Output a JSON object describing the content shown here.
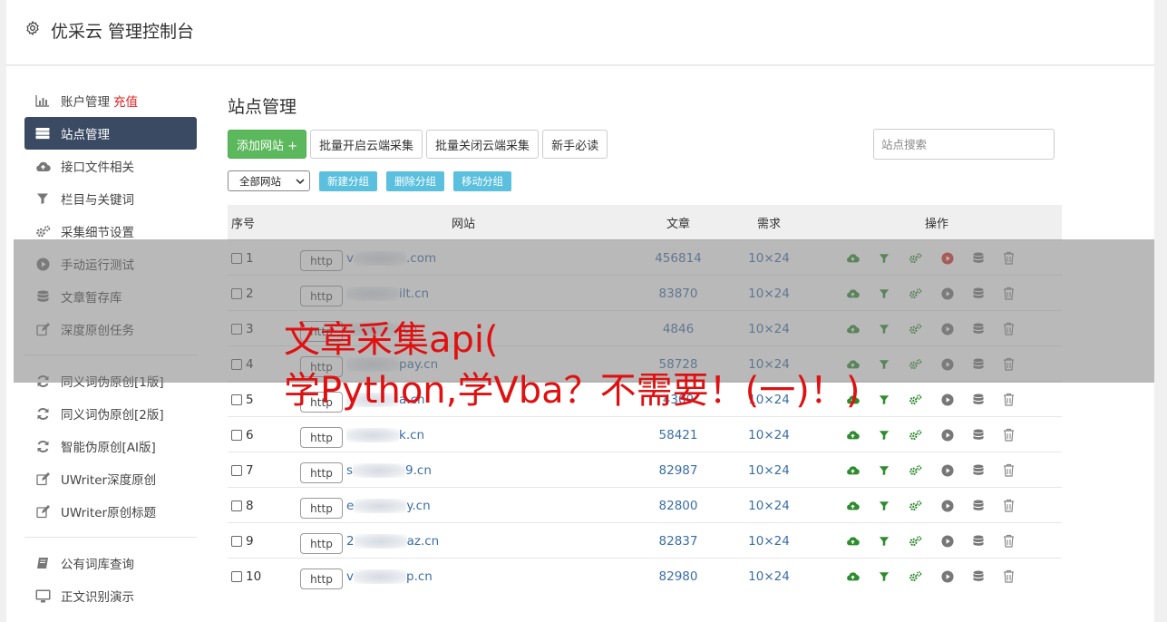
{
  "header": {
    "title": "优采云 管理控制台",
    "icon": "gear-icon"
  },
  "sidebar": {
    "group1": [
      {
        "label": "账户管理",
        "extra": "充值",
        "icon": "bar-chart-icon"
      },
      {
        "label": "站点管理",
        "icon": "server-icon",
        "active": true
      },
      {
        "label": "接口文件相关",
        "icon": "cloud-upload-icon"
      },
      {
        "label": "栏目与关键词",
        "icon": "filter-icon"
      },
      {
        "label": "采集细节设置",
        "icon": "cogs-icon"
      },
      {
        "label": "手动运行测试",
        "icon": "play-circle-icon"
      },
      {
        "label": "文章暂存库",
        "icon": "database-icon"
      },
      {
        "label": "深度原创任务",
        "icon": "edit-icon"
      }
    ],
    "group2": [
      {
        "label": "同义词伪原创[1版]",
        "icon": "refresh-icon"
      },
      {
        "label": "同义词伪原创[2版]",
        "icon": "refresh-icon"
      },
      {
        "label": "智能伪原创[AI版]",
        "icon": "refresh-icon"
      },
      {
        "label": "UWriter深度原创",
        "icon": "edit-icon"
      },
      {
        "label": "UWriter原创标题",
        "icon": "edit-icon"
      }
    ],
    "group3": [
      {
        "label": "公有词库查询",
        "icon": "book-icon"
      },
      {
        "label": "正文识别演示",
        "icon": "monitor-icon"
      }
    ]
  },
  "main": {
    "title": "站点管理",
    "buttons": {
      "add": "添加网站 +",
      "batch_open": "批量开启云端采集",
      "batch_close": "批量关闭云端采集",
      "guide": "新手必读"
    },
    "search_placeholder": "站点搜索",
    "group_select": "全部网站",
    "group_buttons": {
      "new": "新建分组",
      "delete": "删除分组",
      "move": "移动分组"
    },
    "table": {
      "headers": {
        "no": "序号",
        "site": "网站",
        "articles": "文章",
        "need": "需求",
        "ops": "操作"
      },
      "rows": [
        {
          "no": "1",
          "http": "http",
          "pre": "v",
          "post": ".com",
          "articles": "456814",
          "need": "10×24",
          "running": true
        },
        {
          "no": "2",
          "http": "http",
          "pre": "",
          "post": "ilt.cn",
          "articles": "83870",
          "need": "10×24"
        },
        {
          "no": "3",
          "http": "http",
          "pre": "",
          "post": ".cn",
          "articles": "4846",
          "need": "10×24"
        },
        {
          "no": "4",
          "http": "http",
          "pre": "",
          "post": "pay.cn",
          "articles": "58728",
          "need": "10×24"
        },
        {
          "no": "5",
          "http": "http",
          "pre": "",
          "post": "a.cn",
          "articles": "4309",
          "need": "10×24"
        },
        {
          "no": "6",
          "http": "http",
          "pre": "",
          "post": "k.cn",
          "articles": "58421",
          "need": "10×24"
        },
        {
          "no": "7",
          "http": "http",
          "pre": "s",
          "post": "9.cn",
          "articles": "82987",
          "need": "10×24"
        },
        {
          "no": "8",
          "http": "http",
          "pre": "e",
          "post": "y.cn",
          "articles": "82800",
          "need": "10×24"
        },
        {
          "no": "9",
          "http": "http",
          "pre": "2",
          "post": "az.cn",
          "articles": "82837",
          "need": "10×24"
        },
        {
          "no": "10",
          "http": "http",
          "pre": "v",
          "post": "p.cn",
          "articles": "82980",
          "need": "10×24"
        }
      ]
    }
  },
  "watermark": {
    "line1": "文章采集api(",
    "line2": "学Python,学Vba？不需要！(一)！)"
  },
  "colors": {
    "sidebar_active": "#3a4a63",
    "green_button": "#5cb85c",
    "info_button": "#5bc0de",
    "link": "#3a6ea5",
    "watermark": "#e01010",
    "recharge": "#e02020"
  }
}
